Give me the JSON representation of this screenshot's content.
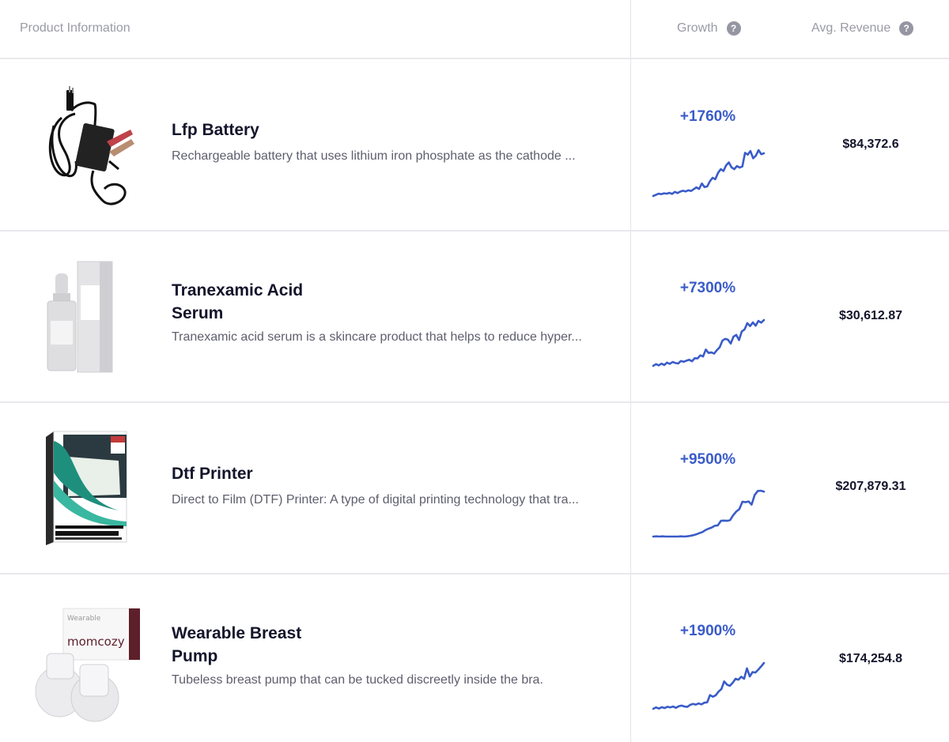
{
  "header": {
    "product_label": "Product Information",
    "growth_label": "Growth",
    "revenue_label": "Avg. Revenue",
    "help_glyph": "?"
  },
  "accent_color": "#3a5cc8",
  "products": [
    {
      "name": "Lfp Battery",
      "description": "Rechargeable battery that uses lithium iron phosphate as the cathode ...",
      "image": "battery-charger-image",
      "growth": "+1760%",
      "avg_revenue": "$84,372.6",
      "trend": [
        5,
        5.5,
        6,
        5.8,
        6.2,
        6,
        6.4,
        5.9,
        6.8,
        6.3,
        6.9,
        7.3,
        7,
        7.5,
        7.2,
        8,
        8.8,
        8.1,
        10.5,
        8.9,
        9.2,
        11.5,
        13,
        12.4,
        15.2,
        16.8,
        16,
        18.5,
        19.8,
        17.6,
        16.8,
        18.2,
        17.5,
        18,
        24,
        23.2,
        24.8,
        21.6,
        22.8,
        25.2,
        23.4,
        23.8
      ]
    },
    {
      "name": "Tranexamic Acid Serum",
      "description": "Tranexamic acid serum is a skincare product that helps to reduce hyper...",
      "image": "serum-bottle-image",
      "growth": "+7300%",
      "avg_revenue": "$30,612.87",
      "trend": [
        5,
        5.8,
        5.2,
        6,
        5.4,
        6.5,
        5.9,
        6.8,
        6.3,
        6.1,
        7.2,
        6.9,
        7.4,
        7.8,
        7.1,
        8.5,
        8.4,
        9.8,
        9.3,
        12.5,
        10.9,
        11.2,
        10.6,
        12.2,
        13.5,
        16.6,
        17.4,
        17,
        15.2,
        18.4,
        19.2,
        16.8,
        20.8,
        21.7,
        24.6,
        23.2,
        24.9,
        23.4,
        25.6,
        24.8,
        26
      ]
    },
    {
      "name": "Dtf Printer",
      "description": "Direct to Film (DTF) Printer: A type of digital printing technology that tra...",
      "image": "dtf-film-box-image",
      "growth": "+9500%",
      "avg_revenue": "$207,879.31",
      "trend": [
        5,
        5.1,
        5,
        5.1,
        5,
        5,
        5,
        5,
        5,
        5.1,
        5,
        5.1,
        5.3,
        5.6,
        6,
        6.5,
        7,
        7.9,
        8.5,
        9,
        9.8,
        10,
        12,
        12.1,
        12,
        12.3,
        14.5,
        16.1,
        17.2,
        20.5,
        20.3,
        20.6,
        19.2,
        23.5,
        25.3,
        25.4,
        25
      ]
    },
    {
      "name": "Wearable Breast Pump",
      "description": "Tubeless breast pump that can be tucked discreetly inside the bra.",
      "image": "breast-pump-image",
      "growth": "+1900%",
      "avg_revenue": "$174,254.8",
      "trend": [
        5,
        5.6,
        5.1,
        5.7,
        5.3,
        5.9,
        5.6,
        6,
        5.4,
        6.1,
        6.4,
        6,
        5.8,
        6.7,
        7.1,
        6.8,
        7.3,
        6.9,
        7.6,
        7.8,
        10.9,
        10.2,
        10.8,
        12.4,
        13.5,
        16.8,
        15.4,
        14.9,
        16.2,
        17.9,
        17.5,
        18.8,
        17.9,
        22.4,
        18.9,
        20.8,
        20.6,
        21.8,
        23.2,
        24.7
      ]
    }
  ]
}
